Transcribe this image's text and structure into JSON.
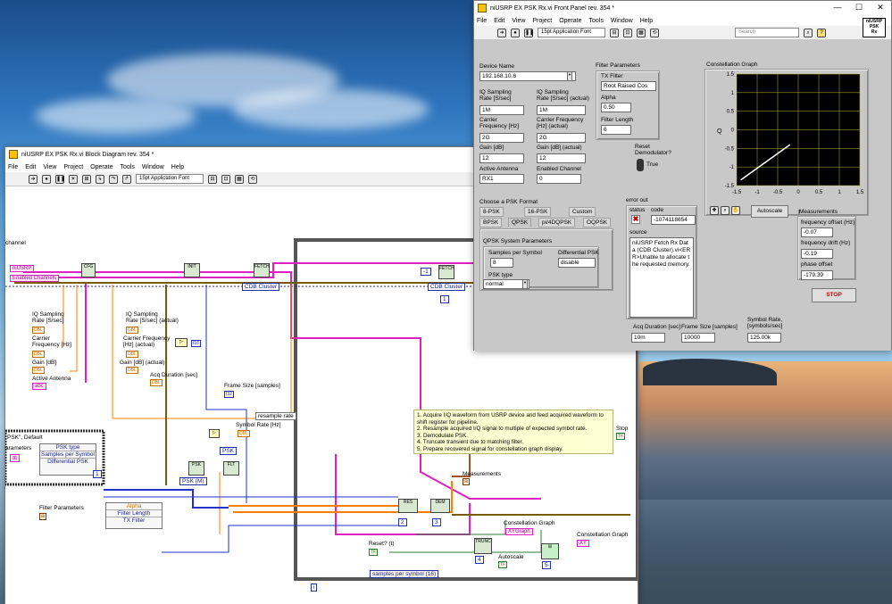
{
  "block_diagram": {
    "title": "niUSRP EX PSK Rx.vi Block Diagram rev. 354 *",
    "menu": [
      "File",
      "Edit",
      "View",
      "Project",
      "Operate",
      "Tools",
      "Window",
      "Help"
    ],
    "font": "15pt Application Font",
    "labels": {
      "channel": "channel",
      "niusrp": "niUSRP",
      "enabled_channels": "Enabled Channels",
      "iq_rate": "IQ Sampling\nRate [S/sec]",
      "carrier": "Carrier\nFrequency [Hz]",
      "gain": "Gain [dB]",
      "active_antenna": "Active Antenna",
      "iq_rate_actual": "IQ Sampling\nRate [S/sec] (actual)",
      "carrier_actual": "Carrier Frequency\n[Hz] (actual)",
      "gain_actual": "Gain [dB] (actual)",
      "acq_duration": "Acq Duration [sec]",
      "frame_size": "Frame Size [samples]",
      "resample_rate": "resample rate",
      "symbol_rate": "Symbol Rate [Hz]",
      "psk_default": "PSK\", Default",
      "parameters": "arameters",
      "psk_type": "PSK type",
      "samples_per_symbol": "Samples per Symbol",
      "differential_psk": "Differential PSK",
      "psk_m": "PSK (M)",
      "psk": "PSK",
      "filter_parameters": "Filter Parameters",
      "alpha": "Alpha",
      "filter_length": "Filter Length",
      "tx_filter": "TX Filter",
      "cdb_cluster": "CDB Cluster",
      "measurements": "Measurements",
      "constellation_graph": "Constellation Graph",
      "xygraph": "XYGraph",
      "reset": "Reset? (t)",
      "autoscale": "Autoscale",
      "samples_per_symbol_16": "samples per symbol (16)",
      "stop": "Stop",
      "neg1": "-1",
      "one": "1",
      "two": "2",
      "three": "3",
      "four": "4",
      "five": "5",
      "i16": "I16"
    },
    "comment": [
      "1. Acquire I/Q waveform from USRP device and  feed acquired waveform to shift register for pipeline.",
      "2. Resample acquired I/Q signal to multiple of expected symbol rate.",
      "3. Demodulate PSK.",
      "4. Truncate transient due to matching filter.",
      "5. Prepare recovered signal for constellation graph display."
    ]
  },
  "front_panel": {
    "title": "niUSRP EX PSK Rx.vi Front Panel rev. 354 *",
    "menu": [
      "File",
      "Edit",
      "View",
      "Project",
      "Operate",
      "Tools",
      "Window",
      "Help"
    ],
    "font": "15pt Application Font",
    "search_placeholder": "Search",
    "vi_icon_lines": [
      "niUSRP",
      "PSK",
      "Rx"
    ],
    "device_name_label": "Device Name",
    "device_name": "192.168.10.6",
    "iq_rate_label": "IQ Sampling\nRate [S/sec]",
    "iq_rate": "1M",
    "iq_rate_actual_label": "IQ Sampling\nRate [S/sec] (actual)",
    "iq_rate_actual": "1M",
    "carrier_label": "Carrier\nFrequency [Hz]",
    "carrier": "2G",
    "carrier_actual_label": "Carrier Frequency\n[Hz] (actual)",
    "carrier_actual": "2G",
    "gain_label": "Gain [dB]",
    "gain": "12",
    "gain_actual_label": "Gain [dB] (actual)",
    "gain_actual": "12",
    "antenna_label": "Active Antenna",
    "antenna": "RX1",
    "enabled_channel_label": "Enabled Channel",
    "enabled_channel": "0",
    "filter_params_label": "Filter Parameters",
    "tx_filter_label": "TX Filter",
    "tx_filter": "Root Raised Cos",
    "alpha_label": "Alpha",
    "alpha": "0.50",
    "filter_length_label": "Filter Length",
    "filter_length": "6",
    "reset_label": "Reset\nDemodulator?",
    "reset_value": "True",
    "psk_format_label": "Choose a PSK Format",
    "psk_tabs_row1": [
      "8-PSK",
      "16-PSK",
      "Custom"
    ],
    "psk_tabs_row2": [
      "BPSK",
      "QPSK",
      "pi/4DQPSK",
      "OQPSK"
    ],
    "psk_selected": "QPSK",
    "qpsk_params_label": "QPSK System Parameters",
    "sps_label": "Samples per Symbol",
    "sps": "8",
    "diff_psk_label": "Differential PSK",
    "diff_psk": "disable",
    "psk_type_label": "PSK type",
    "psk_type": "normal",
    "error_out_label": "error out",
    "status_label": "status",
    "code_label": "code",
    "error_code": "-1074118654",
    "source_label": "source",
    "error_source": "niUSRP Fetch Rx Data (CDB Cluster).vi<ERR>Unable to allocate the requested memory.",
    "acq_duration_label": "Acq Duration [sec]",
    "acq_duration": "10m",
    "frame_size_label": "Frame Size [samples]",
    "frame_size": "10000",
    "symbol_rate_label": "Symbol Rate,\n[symbols/sec]",
    "symbol_rate": "125.00k",
    "graph_title": "Constellation Graph",
    "graph_ylabel": "Q",
    "graph_xlabel": "I",
    "autoscale_label": "Autoscale",
    "measurements_label": "Measurements",
    "freq_offset_label": "frequency offset (Hz)",
    "freq_offset": "-0.07",
    "freq_drift_label": "frequency drift (Hz)",
    "freq_drift": "-0.19",
    "phase_offset_label": "phase offset",
    "phase_offset": "-179.39",
    "stop_label": "STOP",
    "colors": {
      "stop_text": "#d40000",
      "plot_line": "#ffffff",
      "grid": "#b8b830",
      "plot_bg": "#000000"
    }
  },
  "chart_data": {
    "type": "line",
    "title": "Constellation Graph",
    "xlabel": "I",
    "ylabel": "Q",
    "xlim": [
      -1.5,
      1.5
    ],
    "ylim": [
      -1.5,
      1.5
    ],
    "x_ticks": [
      "-1.5",
      "-1",
      "-0.5",
      "0",
      "0.5",
      "1",
      "1.5"
    ],
    "y_ticks": [
      "1.5",
      "1",
      "0.5",
      "0",
      "-0.5",
      "-1",
      "-1.5"
    ],
    "grid": true,
    "series": [
      {
        "x": [
          -1.4,
          -0.2
        ],
        "y": [
          -1.35,
          -0.4
        ]
      }
    ]
  }
}
